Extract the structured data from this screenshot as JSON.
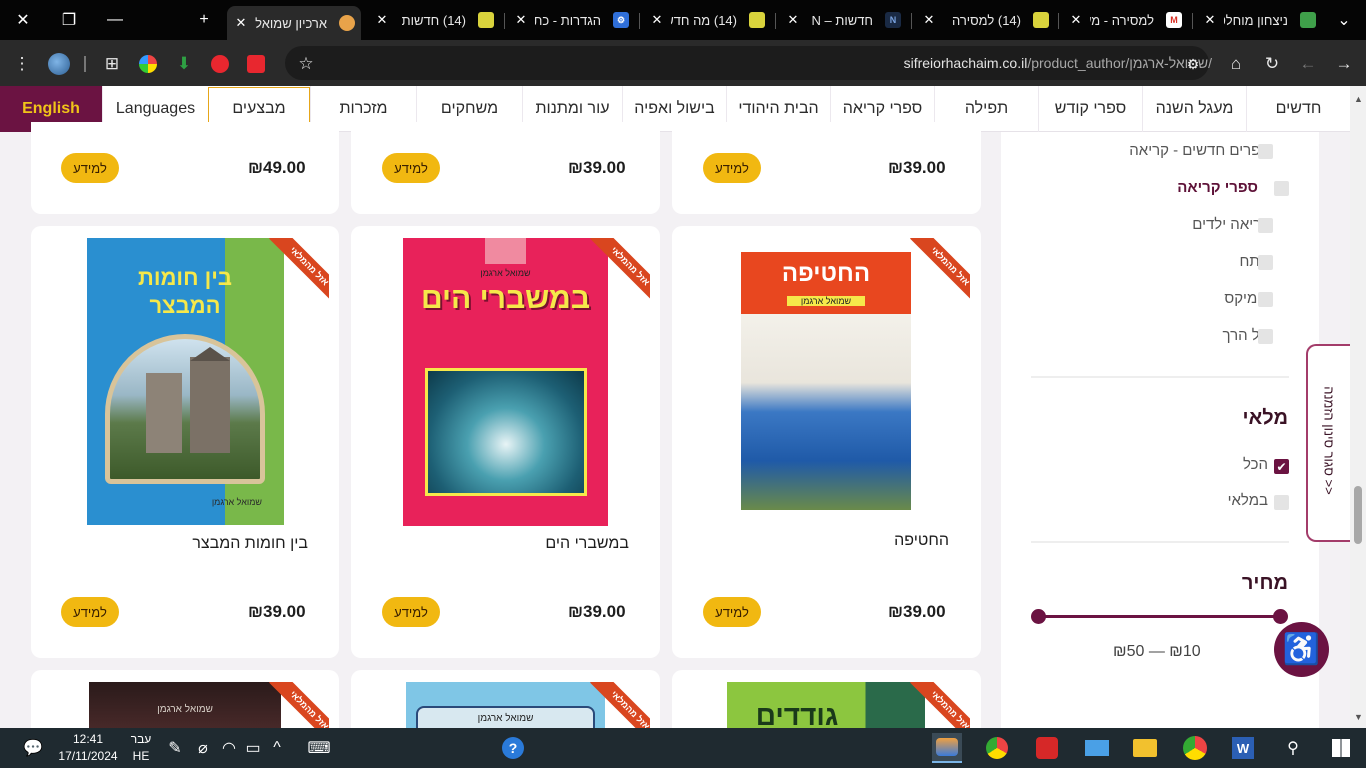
{
  "window_controls": {
    "close": "✕",
    "restore": "❐",
    "minimize": "—",
    "new_tab": "+",
    "tab_search": "⌄"
  },
  "tabs": [
    {
      "title": "ארכיון שמואל",
      "active": true
    },
    {
      "title": "(14) חדשות"
    },
    {
      "title": "הגדרות - כת"
    },
    {
      "title": "(14) מה חדש"
    },
    {
      "title": "חדשות – N"
    },
    {
      "title": "(14) למסירה"
    },
    {
      "title": "למסירה - מע"
    },
    {
      "title": "ניצחון מוחלט"
    }
  ],
  "toolbar": {
    "url_domain": "sifreiorhachaim.co.il",
    "url_path": "/product_author/שמואל-ארגמן/",
    "menu_icon": "⋮",
    "bookmark_icon": "☆",
    "back_icon": "→",
    "forward_icon": "←",
    "reload_icon": "↻",
    "home_icon": "⌂",
    "site_info_icon": "⚙",
    "extensions_icon": "⊞"
  },
  "nav": {
    "items": [
      "חדשים",
      "מעגל השנה",
      "ספרי קודש",
      "תפילה",
      "ספרי קריאה",
      "הבית היהודי",
      "בישול ואפיה",
      "עור ומתנות",
      "משחקים",
      "מזכרות",
      "מבצעים"
    ],
    "languages": "Languages",
    "english": "English"
  },
  "products": {
    "top_row_prices": [
      "₪39.00",
      "₪39.00",
      "₪49.00"
    ],
    "info_label": "למידע",
    "ribbon_label": "אזל מהמלאי",
    "items": [
      {
        "title": "החטיפה",
        "price": "₪39.00",
        "cover_title": "החטיפה",
        "cover_author": "שמואל ארגמן"
      },
      {
        "title": "במשברי הים",
        "price": "₪39.00",
        "cover_title": "במשברי הים",
        "cover_author": "שמואל ארגמן"
      },
      {
        "title": "בין חומות המבצר",
        "price": "₪39.00",
        "cover_title": "בין חומות המבצר",
        "cover_author": "שמואל ארגמן"
      }
    ],
    "bottom_row_covers": [
      "גודדים",
      "שמואל ארגמן",
      "שמואל ארגמן"
    ]
  },
  "sidebar": {
    "categories": [
      {
        "label": "ספרים חדשים - קריאה"
      },
      {
        "label": "ספרי קריאה",
        "selected": true
      },
      {
        "label": "קריאה ילדים"
      },
      {
        "label": "מתח"
      },
      {
        "label": "קומיקס"
      },
      {
        "label": "גיל הרך"
      }
    ],
    "stock_title": "מלאי",
    "stock_options": [
      {
        "label": "הכל",
        "checked": true
      },
      {
        "label": "במלאי",
        "checked": false
      }
    ],
    "price_title": "מחיר",
    "price_range": "₪10 — ₪50",
    "filter_tab": "<< סגור סינון הזמנה",
    "accessibility_icon": "♿"
  },
  "taskbar": {
    "time": "12:41",
    "date": "17/11/2024",
    "lang_top": "עבר",
    "lang_bottom": "HE"
  },
  "colors": {
    "brand": "#6b1342",
    "accent": "#f1b811",
    "ribbon": "#d9461f"
  }
}
